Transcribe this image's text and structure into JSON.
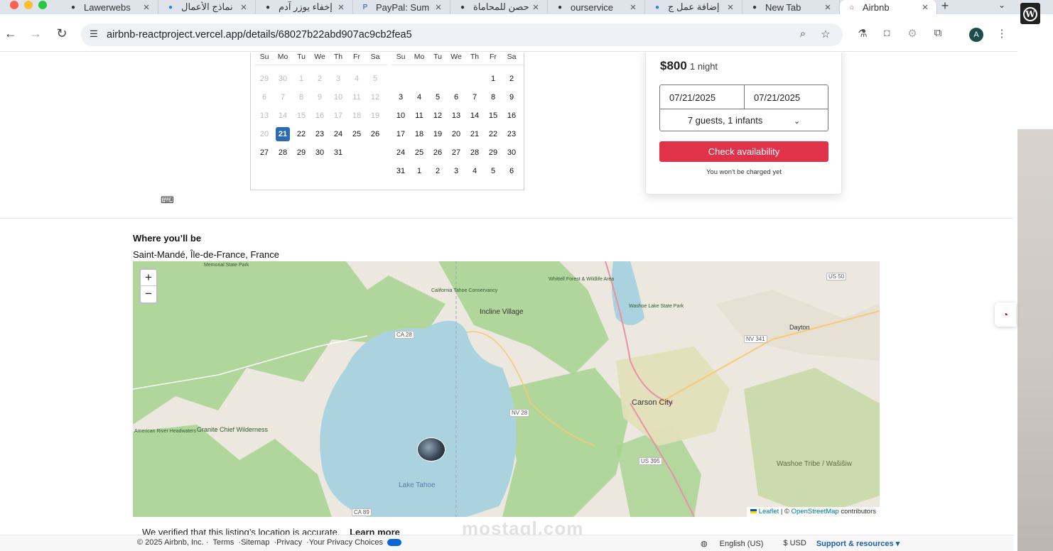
{
  "browser": {
    "tabs": [
      {
        "title": "Lawerwebs",
        "icon": "law-favicon-icon"
      },
      {
        "title": "نماذج الأعمال",
        "icon": "circle-favicon-icon"
      },
      {
        "title": "إخفاء يوزر آدم",
        "icon": "openai-favicon-icon"
      },
      {
        "title": "PayPal: Sum",
        "icon": "paypal-favicon-icon"
      },
      {
        "title": "حصن للمحاماة",
        "icon": "page-favicon-icon"
      },
      {
        "title": "ourservice",
        "icon": "page-favicon-icon"
      },
      {
        "title": "إضافة عمل ج",
        "icon": "circle-favicon-icon"
      },
      {
        "title": "New Tab",
        "icon": "chrome-favicon-icon"
      },
      {
        "title": "Airbnb",
        "icon": "airbnb-favicon-icon",
        "active": true
      }
    ],
    "new_tab": "+",
    "url": "airbnb-reactproject.vercel.app/details/68027b22abd907ac9cb2fea5",
    "profile_initial": "A"
  },
  "calendar": {
    "weekdays": [
      "Su",
      "Mo",
      "Tu",
      "We",
      "Th",
      "Fr",
      "Sa"
    ],
    "month1": [
      [
        "29",
        "30",
        "1",
        "2",
        "3",
        "4",
        "5"
      ],
      [
        "6",
        "7",
        "8",
        "9",
        "10",
        "11",
        "12"
      ],
      [
        "13",
        "14",
        "15",
        "16",
        "17",
        "18",
        "19"
      ],
      [
        "20",
        "21",
        "22",
        "23",
        "24",
        "25",
        "26"
      ],
      [
        "27",
        "28",
        "29",
        "30",
        "31",
        "",
        ""
      ]
    ],
    "month1_selected": "21",
    "month2": [
      [
        "",
        "",
        "",
        "",
        "",
        "1",
        "2"
      ],
      [
        "3",
        "4",
        "5",
        "6",
        "7",
        "8",
        "9"
      ],
      [
        "10",
        "11",
        "12",
        "13",
        "14",
        "15",
        "16"
      ],
      [
        "17",
        "18",
        "19",
        "20",
        "21",
        "22",
        "23"
      ],
      [
        "24",
        "25",
        "26",
        "27",
        "28",
        "29",
        "30"
      ],
      [
        "31",
        "1",
        "2",
        "3",
        "4",
        "5",
        "6"
      ]
    ]
  },
  "booking": {
    "price": "$800",
    "per": "1 night",
    "checkin": "07/21/2025",
    "checkout": "07/21/2025",
    "guests": "7 guests, 1 infants",
    "cta": "Check availability",
    "note": "You won't be charged yet"
  },
  "location": {
    "heading": "Where you’ll be",
    "place": "Saint-Mandé, Île-de-France, France",
    "verified": "We verified that this listing’s location is accurate.",
    "learn_more": "Learn more"
  },
  "map": {
    "zoom_in": "+",
    "zoom_out": "−",
    "labels": [
      "Incline Village",
      "Carson City",
      "Lake Tahoe",
      "Dayton",
      "Granite Chief Wilderness",
      "Washoe Lake State Park",
      "Washoe Tribe / Wašiŝiw",
      "American River Headwaters",
      "California Tahoe Conservancy",
      "Whittell Forest & Wildlife Area",
      "Memorial State Park",
      "CA 28",
      "NV 28",
      "US 50",
      "NV 341",
      "US 395",
      "CA 89"
    ],
    "attribution_leaflet": "Leaflet",
    "attribution_sep": " | © ",
    "attribution_osm": "OpenStreetMap",
    "attribution_end": " contributors"
  },
  "watermark": "mostaql.com",
  "footer": {
    "copyright": "© 2025 Airbnb, Inc. ·",
    "terms": "Terms",
    "sitemap": "·Sitemap",
    "privacy": "·Privacy",
    "choices": "·Your Privacy Choices",
    "language": "English (US)",
    "currency": "$ USD",
    "support": "Support & resources ▾"
  },
  "colors": {
    "accent": "#e0334a",
    "selected_day": "#2a6bb1",
    "forest": "#a6d28f",
    "lake": "#aad3df"
  }
}
